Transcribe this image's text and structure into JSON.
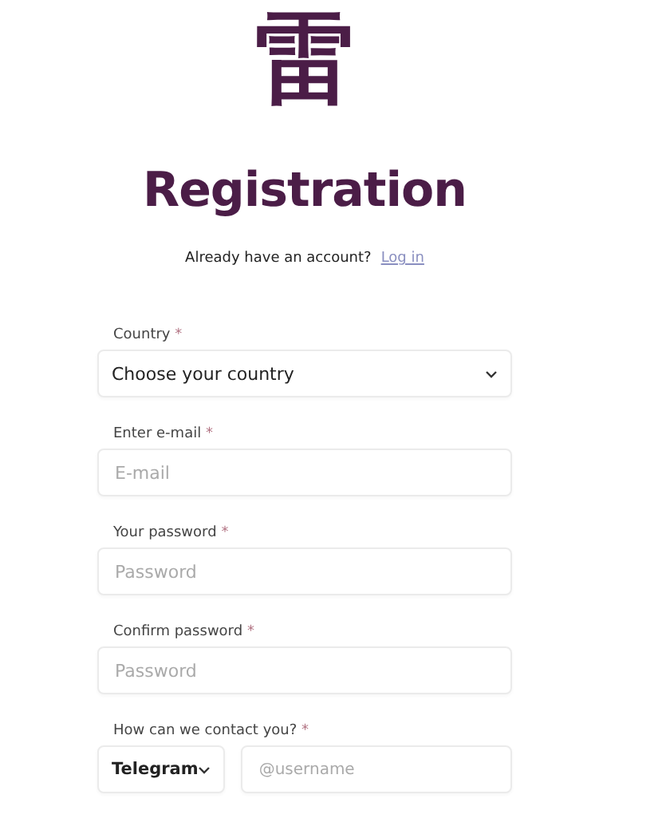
{
  "logo": {
    "glyph": "雷"
  },
  "title": "Registration",
  "login_prompt": {
    "text": "Already have an account?",
    "link": "Log in"
  },
  "fields": [
    {
      "kind": "select",
      "label": "Country",
      "required": true,
      "value": "Choose your country"
    },
    {
      "kind": "input",
      "label": "Enter e-mail",
      "required": true,
      "placeholder": "E-mail"
    },
    {
      "kind": "input",
      "label": "Your password",
      "required": true,
      "placeholder": "Password"
    },
    {
      "kind": "input",
      "label": "Confirm password",
      "required": true,
      "placeholder": "Password"
    }
  ],
  "contact": {
    "label": "How can we contact you?",
    "required": true,
    "method": "Telegram",
    "placeholder": "@username"
  },
  "required_mark": "*"
}
